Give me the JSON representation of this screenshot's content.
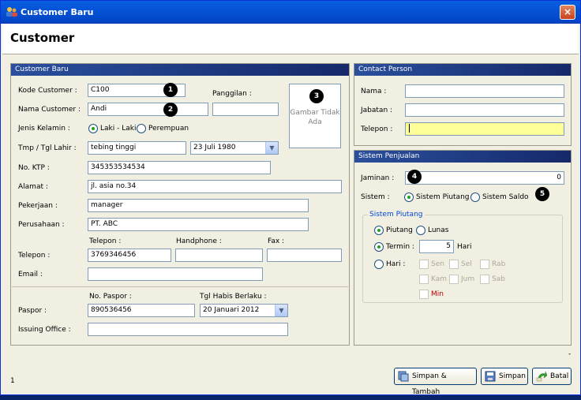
{
  "window": {
    "title": "Customer Baru",
    "close": "×"
  },
  "header": {
    "title": "Customer"
  },
  "customer": {
    "panel_title": "Customer Baru",
    "kode_label": "Kode Customer :",
    "kode_value": "C100",
    "panggilan_label": "Panggilan :",
    "panggilan_value": "",
    "nama_label": "Nama Customer :",
    "nama_value": "Andi",
    "photo_text": "Gambar Tidak Ada",
    "jenis_label": "Jenis Kelamin :",
    "jenis_options": [
      "Laki - Laki",
      "Perempuan"
    ],
    "jenis_selected": "Laki - Laki",
    "ttl_label": "Tmp / Tgl Lahir :",
    "tempat_value": "tebing tinggi",
    "tanggal_value": "23 Juli 1980",
    "ktp_label": "No. KTP :",
    "ktp_value": "345353534534",
    "alamat_label": "Alamat :",
    "alamat_value": "jl. asia no.34",
    "pekerjaan_label": "Pekerjaan :",
    "pekerjaan_value": "manager",
    "perusahaan_label": "Perusahaan :",
    "perusahaan_value": "PT. ABC",
    "telepon_label": "Telepon :",
    "telepon_col_label": "Telepon :",
    "telepon_value": "3769346456",
    "handphone_label": "Handphone :",
    "handphone_value": "",
    "fax_label": "Fax :",
    "fax_value": "",
    "email_label": "Email :",
    "email_value": "",
    "paspor_label": "Paspor :",
    "no_paspor_label": "No. Paspor :",
    "no_paspor_value": "890536456",
    "tgl_habis_label": "Tgl Habis Berlaku :",
    "tgl_habis_value": "20 Januari 2012",
    "issuing_label": "Issuing Office :",
    "issuing_value": ""
  },
  "contact": {
    "panel_title": "Contact Person",
    "nama_label": "Nama :",
    "nama_value": "",
    "jabatan_label": "Jabatan :",
    "jabatan_value": "",
    "telepon_label": "Telepon :",
    "telepon_value": ""
  },
  "penjualan": {
    "panel_title": "Sistem Penjualan",
    "jaminan_label": "Jaminan :",
    "jaminan_value": "0",
    "sistem_label": "Sistem :",
    "sistem_options": [
      "Sistem Piutang",
      "Sistem Saldo"
    ],
    "sistem_selected": "Sistem Piutang",
    "piutang_group_title": "Sistem Piutang",
    "piutang_options": [
      "Piutang",
      "Lunas"
    ],
    "piutang_selected": "Piutang",
    "termin_label": "Termin :",
    "termin_value": "5",
    "termin_unit": "Hari",
    "hari_label": "Hari :",
    "days": [
      "Sen",
      "Sel",
      "Rab",
      "Kam",
      "Jum",
      "Sab",
      "Min"
    ],
    "min_color": "#c00000"
  },
  "badges": [
    "1",
    "2",
    "3",
    "4",
    "5"
  ],
  "buttons": {
    "simpan_tambah": "Simpan & Tambah",
    "simpan": "Simpan",
    "batal": "Batal"
  },
  "status": {
    "left": "1",
    "right": "-"
  },
  "icons": {
    "app": "users-icon",
    "close": "close-icon",
    "combo": "chevron-down-icon",
    "simpan_tambah": "save-add-icon",
    "simpan": "floppy-disk-icon",
    "batal": "cancel-arrow-icon"
  }
}
